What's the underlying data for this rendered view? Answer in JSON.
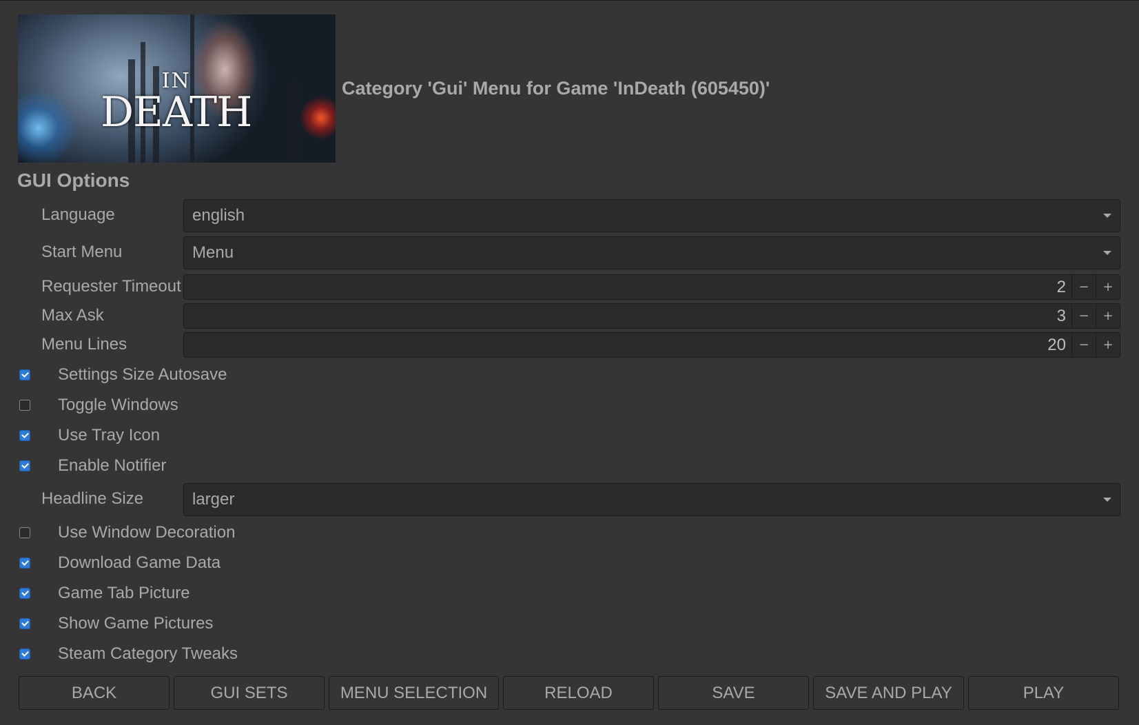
{
  "header": {
    "banner_logo_in": "IN",
    "banner_logo_death": "DEATH",
    "title": "Category 'Gui' Menu for Game 'InDeath (605450)'"
  },
  "section_title": "GUI Options",
  "fields": {
    "language": {
      "label": "Language",
      "value": "english"
    },
    "start_menu": {
      "label": "Start Menu",
      "value": "Menu"
    },
    "requester_timeout": {
      "label": "Requester Timeout",
      "value": "2"
    },
    "max_ask": {
      "label": "Max Ask",
      "value": "3"
    },
    "menu_lines": {
      "label": "Menu Lines",
      "value": "20"
    },
    "headline_size": {
      "label": "Headline Size",
      "value": "larger"
    }
  },
  "spin_buttons": {
    "minus": "−",
    "plus": "+"
  },
  "checkboxes": {
    "settings_size_autosave": {
      "label": "Settings Size Autosave",
      "checked": true
    },
    "toggle_windows": {
      "label": "Toggle Windows",
      "checked": false
    },
    "use_tray_icon": {
      "label": "Use Tray Icon",
      "checked": true
    },
    "enable_notifier": {
      "label": "Enable Notifier",
      "checked": true
    },
    "use_window_decoration": {
      "label": "Use Window Decoration",
      "checked": false
    },
    "download_game_data": {
      "label": "Download Game Data",
      "checked": true
    },
    "game_tab_picture": {
      "label": "Game Tab Picture",
      "checked": true
    },
    "show_game_pictures": {
      "label": "Show Game Pictures",
      "checked": true
    },
    "steam_category_tweaks": {
      "label": "Steam Category Tweaks",
      "checked": true
    }
  },
  "buttons": {
    "back": "BACK",
    "gui_sets": "GUI SETS",
    "menu_selection": "MENU SELECTION",
    "reload": "RELOAD",
    "save": "SAVE",
    "save_and_play": "SAVE AND PLAY",
    "play": "PLAY"
  },
  "colors": {
    "background": "#353535",
    "field_background": "#2b2b2b",
    "text": "#a9a9a9",
    "checkbox_accent": "#2f7ad6"
  }
}
